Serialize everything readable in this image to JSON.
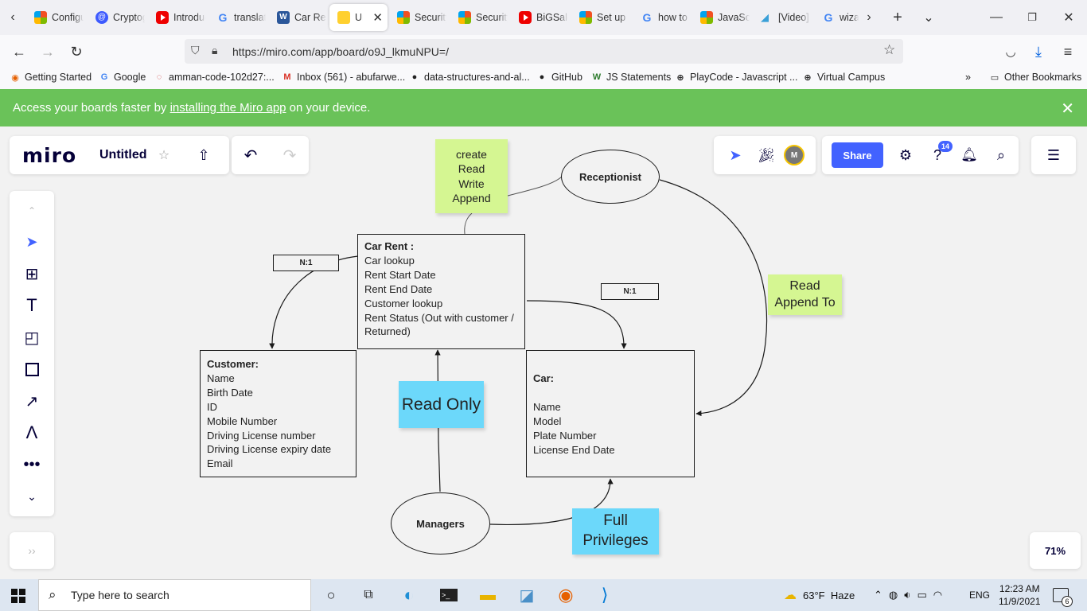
{
  "browser": {
    "tabs": [
      {
        "title": "Configuring",
        "icon": "microsoft-icon"
      },
      {
        "title": "Cryptography",
        "icon": "cryptography-icon"
      },
      {
        "title": "Introduction",
        "icon": "youtube-icon"
      },
      {
        "title": "translate",
        "icon": "google-icon"
      },
      {
        "title": "Car Rent",
        "icon": "word-icon"
      },
      {
        "title": "Untitled",
        "icon": "miro-icon",
        "active": true
      },
      {
        "title": "Security",
        "icon": "microsoft-icon"
      },
      {
        "title": "Security",
        "icon": "microsoft-icon"
      },
      {
        "title": "BiGSale",
        "icon": "youtube-icon"
      },
      {
        "title": "Set up",
        "icon": "microsoft-icon"
      },
      {
        "title": "how to",
        "icon": "google-icon"
      },
      {
        "title": "JavaScript",
        "icon": "microsoft-icon"
      },
      {
        "title": "[Video]",
        "icon": "video-icon"
      },
      {
        "title": "wizard",
        "icon": "google-icon"
      }
    ],
    "url": "https://miro.com/app/board/o9J_lkmuNPU=/",
    "bookmarks": [
      {
        "label": "Getting Started"
      },
      {
        "label": "Google"
      },
      {
        "label": "amman-code-102d27:..."
      },
      {
        "label": "Inbox (561) - abufarwe..."
      },
      {
        "label": "data-structures-and-al..."
      },
      {
        "label": "GitHub"
      },
      {
        "label": "JS Statements"
      },
      {
        "label": "PlayCode - Javascript ..."
      },
      {
        "label": "Virtual Campus"
      }
    ],
    "other_bookmarks": "Other Bookmarks"
  },
  "banner": {
    "prefix": "Access your boards faster by ",
    "link": "installing the Miro app",
    "suffix": " on your device."
  },
  "miro": {
    "logo": "miro",
    "board_title": "Untitled",
    "share_label": "Share",
    "notifications_badge": "14",
    "avatar_initial": "M",
    "zoom": "71%"
  },
  "diagram": {
    "sticky_create": "create\nRead\nWrite\nAppend",
    "sticky_read_append": "Read\nAppend To",
    "sticky_read_only": "Read Only",
    "sticky_full": "Full\nPrivileges",
    "receptionist": "Receptionist",
    "managers": "Managers",
    "tag_left": "N:1",
    "tag_right": "N:1",
    "car_rent": {
      "title": "Car Rent :",
      "lines": [
        "Car lookup",
        "Rent Start Date",
        "Rent End Date",
        "Customer lookup",
        "Rent Status (Out with customer /",
        "Returned)"
      ]
    },
    "customer": {
      "title": "Customer:",
      "lines": [
        "Name",
        "Birth Date",
        "ID",
        "Mobile Number",
        "Driving License number",
        "Driving License expiry date",
        "Email"
      ]
    },
    "car": {
      "title": "Car:",
      "lines": [
        "",
        "Name",
        "Model",
        "Plate Number",
        "License End Date"
      ]
    }
  },
  "taskbar": {
    "search_placeholder": "Type here to search",
    "weather": "63°F  Haze",
    "language": "ENG",
    "time": "12:23 AM",
    "date": "11/9/2021",
    "notification_count": "6"
  }
}
